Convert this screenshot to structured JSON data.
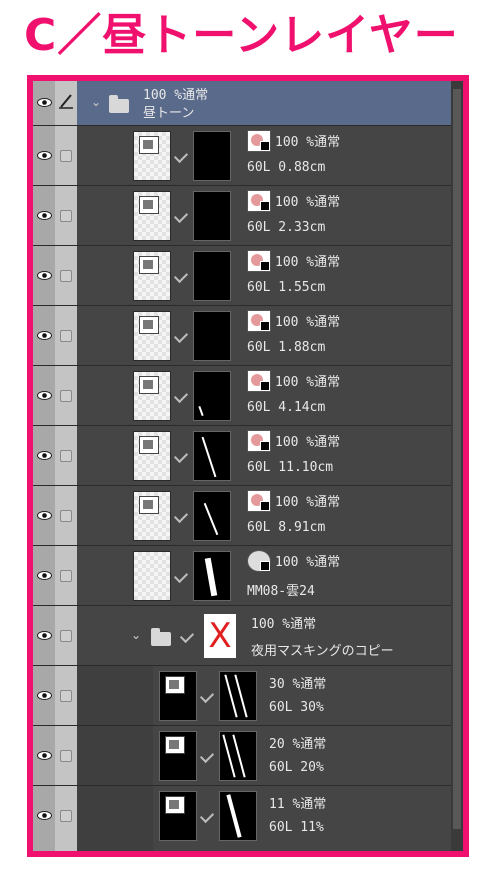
{
  "title": "C／昼トーンレイヤー",
  "colors": {
    "accent": "#f0106e",
    "panel_bg": "#3f3f3f",
    "selected_row": "#5a6a8a"
  },
  "folder": {
    "blend": "100 %通常",
    "name": "昼トーン"
  },
  "layers": [
    {
      "blend": "100 %通常",
      "info": "60L 0.88cm"
    },
    {
      "blend": "100 %通常",
      "info": "60L 2.33cm"
    },
    {
      "blend": "100 %通常",
      "info": "60L 1.55cm"
    },
    {
      "blend": "100 %通常",
      "info": "60L 1.88cm"
    },
    {
      "blend": "100 %通常",
      "info": "60L 4.14cm"
    },
    {
      "blend": "100 %通常",
      "info": "60L 11.10cm"
    },
    {
      "blend": "100 %通常",
      "info": "60L 8.91cm"
    },
    {
      "blend": "100 %通常",
      "info": "MM08-雲24"
    }
  ],
  "subfolder": {
    "blend": "100 %通常",
    "name": "夜用マスキングのコピー"
  },
  "sublayers": [
    {
      "blend": "30 %通常",
      "info": "60L 30%"
    },
    {
      "blend": "20 %通常",
      "info": "60L 20%"
    },
    {
      "blend": "11 %通常",
      "info": "60L 11%"
    }
  ]
}
